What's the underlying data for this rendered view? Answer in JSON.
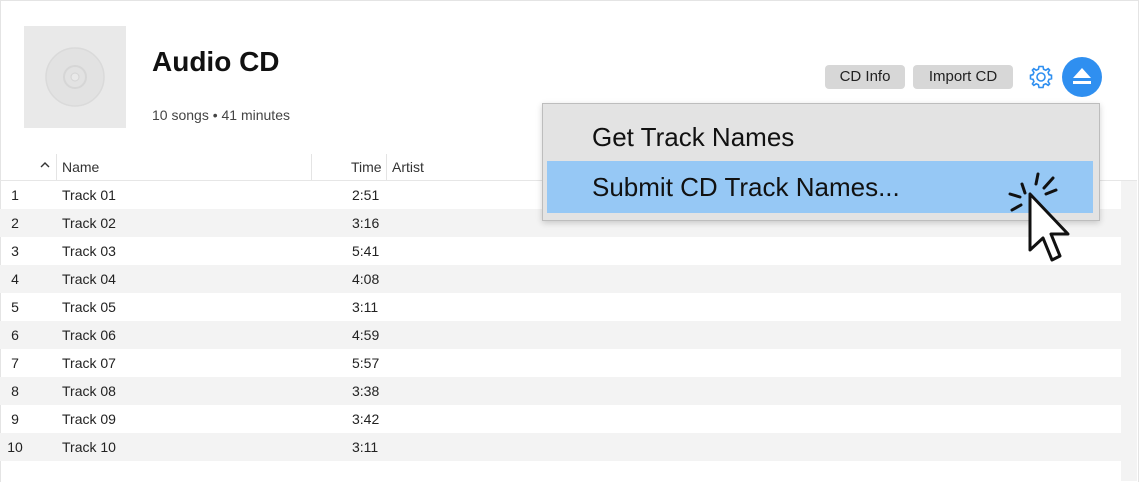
{
  "album": {
    "title": "Audio CD",
    "subtitle": "10 songs • 41 minutes"
  },
  "toolbar": {
    "cd_info_label": "CD Info",
    "import_cd_label": "Import CD",
    "settings_icon": "gear-icon",
    "eject_icon": "eject-icon",
    "accent_color": "#2f8ff0"
  },
  "table": {
    "columns": {
      "name": "Name",
      "time": "Time",
      "artist": "Artist"
    },
    "sort_icon": "chevron-up-icon",
    "rows": [
      {
        "num": "1",
        "name": "Track 01",
        "time": "2:51"
      },
      {
        "num": "2",
        "name": "Track 02",
        "time": "3:16"
      },
      {
        "num": "3",
        "name": "Track 03",
        "time": "5:41"
      },
      {
        "num": "4",
        "name": "Track 04",
        "time": "4:08"
      },
      {
        "num": "5",
        "name": "Track 05",
        "time": "3:11"
      },
      {
        "num": "6",
        "name": "Track 06",
        "time": "4:59"
      },
      {
        "num": "7",
        "name": "Track 07",
        "time": "5:57"
      },
      {
        "num": "8",
        "name": "Track 08",
        "time": "3:38"
      },
      {
        "num": "9",
        "name": "Track 09",
        "time": "3:42"
      },
      {
        "num": "10",
        "name": "Track 10",
        "time": "3:11"
      }
    ]
  },
  "context_menu": {
    "items": [
      {
        "label": "Get Track Names",
        "highlighted": false
      },
      {
        "label": "Submit CD Track Names...",
        "highlighted": true
      }
    ],
    "highlight_color": "#96c8f5"
  }
}
